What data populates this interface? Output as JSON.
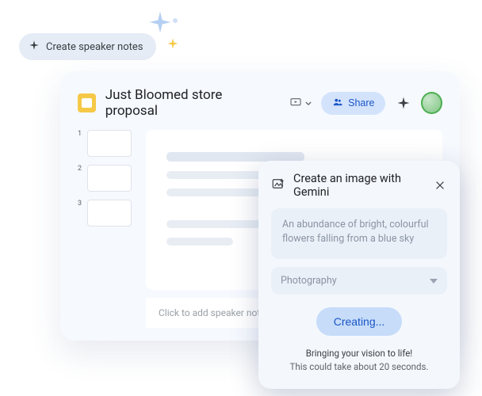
{
  "chip": {
    "label": "Create speaker notes"
  },
  "document": {
    "title": "Just Bloomed store proposal"
  },
  "toolbar": {
    "share_label": "Share"
  },
  "slides": {
    "thumbs": [
      {
        "n": "1"
      },
      {
        "n": "2"
      },
      {
        "n": "3"
      }
    ]
  },
  "speaker_notes": {
    "placeholder": "Click to add speaker notes"
  },
  "gemini": {
    "title": "Create an image with Gemini",
    "prompt": "An abundance of bright, colourful flowers falling from a blue sky",
    "style": "Photography",
    "button_label": "Creating...",
    "status_1": "Bringing your vision to life!",
    "status_2": "This could take about 20 seconds."
  },
  "icons": {
    "sparkle": "sparkle-icon",
    "slides_app": "slides-app-icon",
    "present": "present-icon",
    "people": "people-icon",
    "gemini": "gemini-icon",
    "image_sparkle": "image-sparkle-icon",
    "close": "close-icon",
    "chevron_down": "chevron-down-icon"
  }
}
